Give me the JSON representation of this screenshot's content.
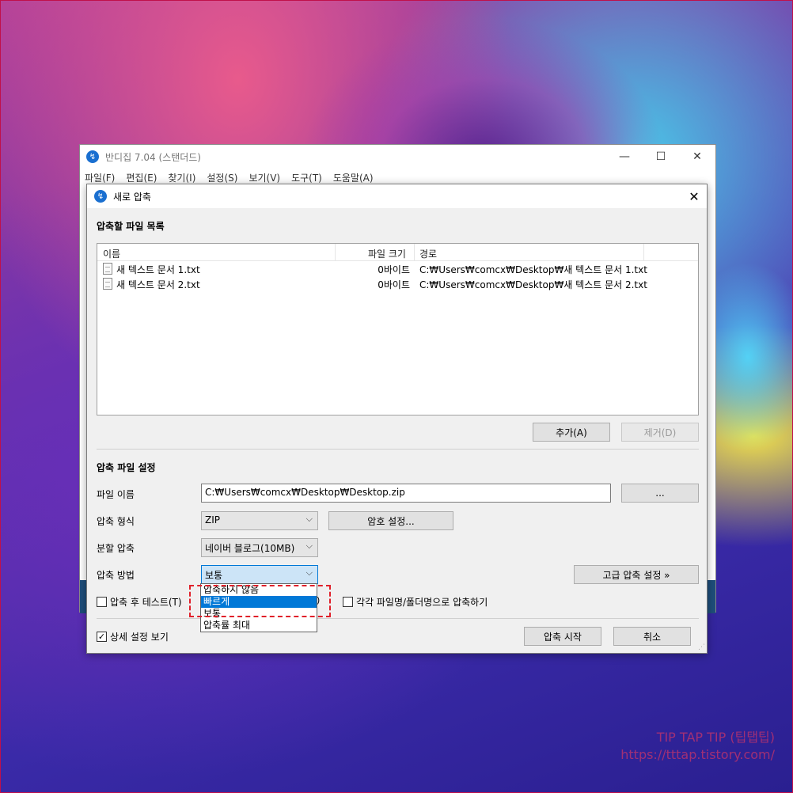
{
  "main_window": {
    "title": "반디집 7.04 (스탠더드)",
    "menu": [
      "파일(F)",
      "편집(E)",
      "찾기(I)",
      "설정(S)",
      "보기(V)",
      "도구(T)",
      "도움말(A)"
    ]
  },
  "dialog": {
    "title": "새로 압축",
    "file_list_section": "압축할 파일 목록",
    "columns": {
      "name": "이름",
      "size": "파일 크기",
      "path": "경로"
    },
    "files": [
      {
        "name": "새 텍스트 문서 1.txt",
        "size": "0바이트",
        "path": "C:₩Users₩comcx₩Desktop₩새 텍스트 문서 1.txt"
      },
      {
        "name": "새 텍스트 문서 2.txt",
        "size": "0바이트",
        "path": "C:₩Users₩comcx₩Desktop₩새 텍스트 문서 2.txt"
      }
    ],
    "add_button": "추가(A)",
    "remove_button": "제거(D)",
    "settings_section": "압축 파일 설정",
    "filename_label": "파일 이름",
    "filename_value": "C:₩Users₩comcx₩Desktop₩Desktop.zip",
    "browse_button": "...",
    "format_label": "압축 형식",
    "format_value": "ZIP",
    "password_button": "암호 설정...",
    "split_label": "분할 압축",
    "split_value": "네이버 블로그(10MB)",
    "method_label": "압축 방법",
    "method_value": "보통",
    "advanced_button": "고급 압축 설정 »",
    "method_options": [
      "압축하지 않음",
      "빠르게",
      "보통",
      "압축률 최대"
    ],
    "method_highlighted": "빠르게",
    "test_after_checkbox": "압축 후 테스트(T)",
    "test_after_checked": false,
    "hidden_checkbox_tail": ")",
    "each_folder_checkbox": "각각 파일명/폴더명으로 압축하기",
    "each_folder_checked": false,
    "show_details_checkbox": "상세 설정 보기",
    "show_details_checked": true,
    "start_button": "압축 시작",
    "cancel_button": "취소"
  },
  "watermark": {
    "line1": "TIP TAP TIP (팁탭팁)",
    "line2": "https://tttap.tistory.com/"
  },
  "colors": {
    "accent": "#0078d7",
    "highlight_border": "#e0202a",
    "app_logo": "#1a6fd0"
  },
  "icons": {
    "logo": "bandizip-logo-icon",
    "file": "text-file-icon",
    "dropdown": "chevron-down-icon"
  }
}
